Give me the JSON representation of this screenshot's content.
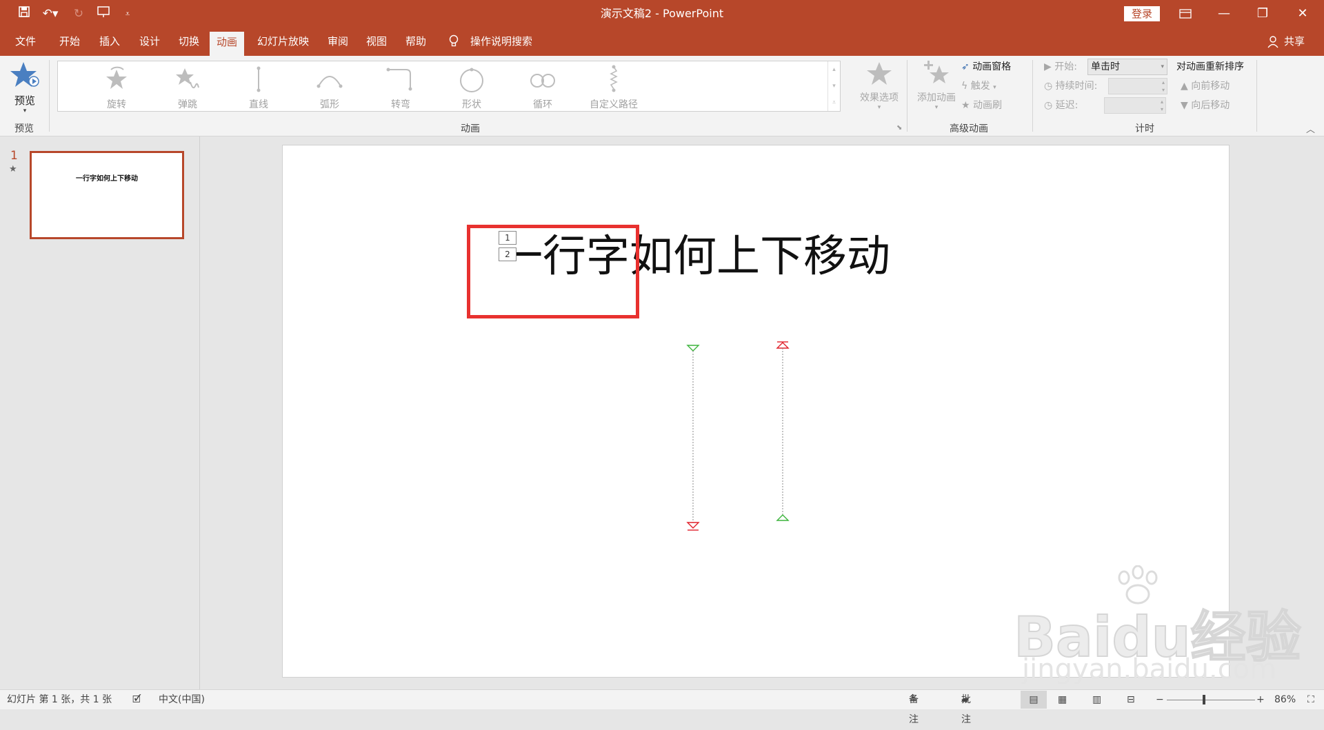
{
  "window": {
    "title": "演示文稿2 - PowerPoint",
    "login": "登录"
  },
  "menu": {
    "file": "文件",
    "tabs": [
      "开始",
      "插入",
      "设计",
      "切换",
      "动画",
      "幻灯片放映",
      "审阅",
      "视图",
      "帮助"
    ],
    "search": "操作说明搜索",
    "share": "共享"
  },
  "ribbon": {
    "preview": "预览",
    "preview_group": "预览",
    "gallery": [
      {
        "icon": "rotate",
        "label": "旋转"
      },
      {
        "icon": "bounce",
        "label": "弹跳"
      },
      {
        "icon": "line",
        "label": "直线"
      },
      {
        "icon": "arc",
        "label": "弧形"
      },
      {
        "icon": "turn",
        "label": "转弯"
      },
      {
        "icon": "shape",
        "label": "形状"
      },
      {
        "icon": "loop",
        "label": "循环"
      },
      {
        "icon": "custom-path",
        "label": "自定义路径"
      }
    ],
    "effect_options": "效果选项",
    "animation_group": "动画",
    "add_animation": "添加动画",
    "anim_pane": "动画窗格",
    "trigger": "触发",
    "anim_painter": "动画刷",
    "advanced_group": "高级动画",
    "start_label": "开始:",
    "start_value": "单击时",
    "duration_label": "持续时间:",
    "delay_label": "延迟:",
    "timing_group": "计时",
    "reorder_title": "对动画重新排序",
    "move_earlier": "向前移动",
    "move_later": "向后移动"
  },
  "slides": {
    "number": "1",
    "star": "★",
    "thumb_title": "一行字如何上下移动"
  },
  "slide": {
    "title": "一行字如何上下移动",
    "anim_tags": [
      "1",
      "2"
    ]
  },
  "watermark": {
    "brand": "Baidu经验",
    "url": "jingyan.baidu.com"
  },
  "status": {
    "slide_info": "幻灯片 第 1 张，共 1 张",
    "language": "中文(中国)",
    "notes": "备注",
    "comments": "批注",
    "zoom": "86%"
  },
  "colors": {
    "accent": "#B7472A",
    "highlight_box": "#E8312F",
    "path_start": "#3CB43C",
    "path_end": "#E0202A"
  }
}
